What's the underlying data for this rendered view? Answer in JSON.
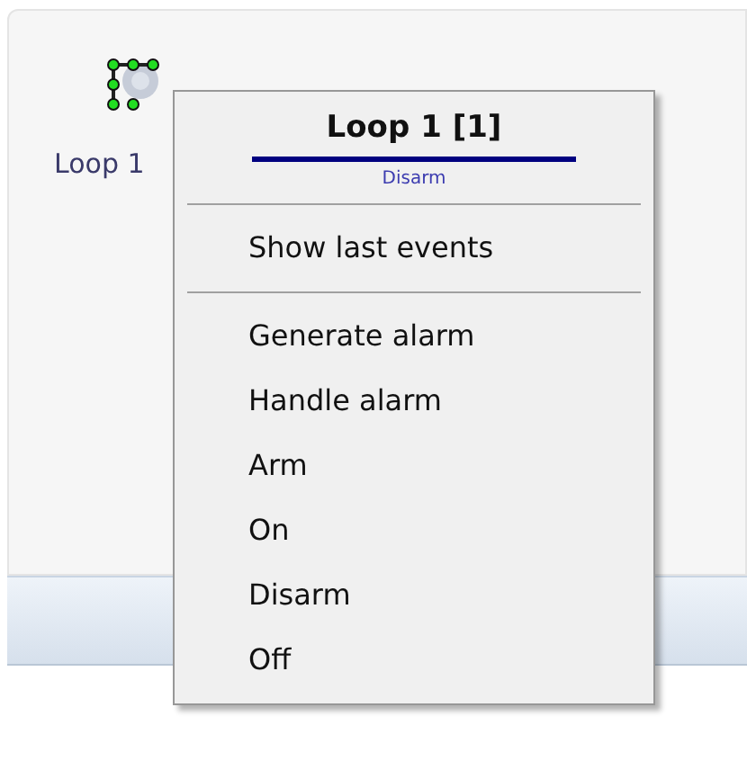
{
  "canvas": {
    "node": {
      "label": "Loop 1",
      "selected": true
    }
  },
  "context_menu": {
    "title": "Loop 1 [1]",
    "status": "Disarm",
    "sections": [
      {
        "items": [
          "Show last events"
        ]
      },
      {
        "items": [
          "Generate alarm",
          "Handle alarm",
          "Arm",
          "On",
          "Disarm",
          "Off"
        ]
      }
    ]
  }
}
